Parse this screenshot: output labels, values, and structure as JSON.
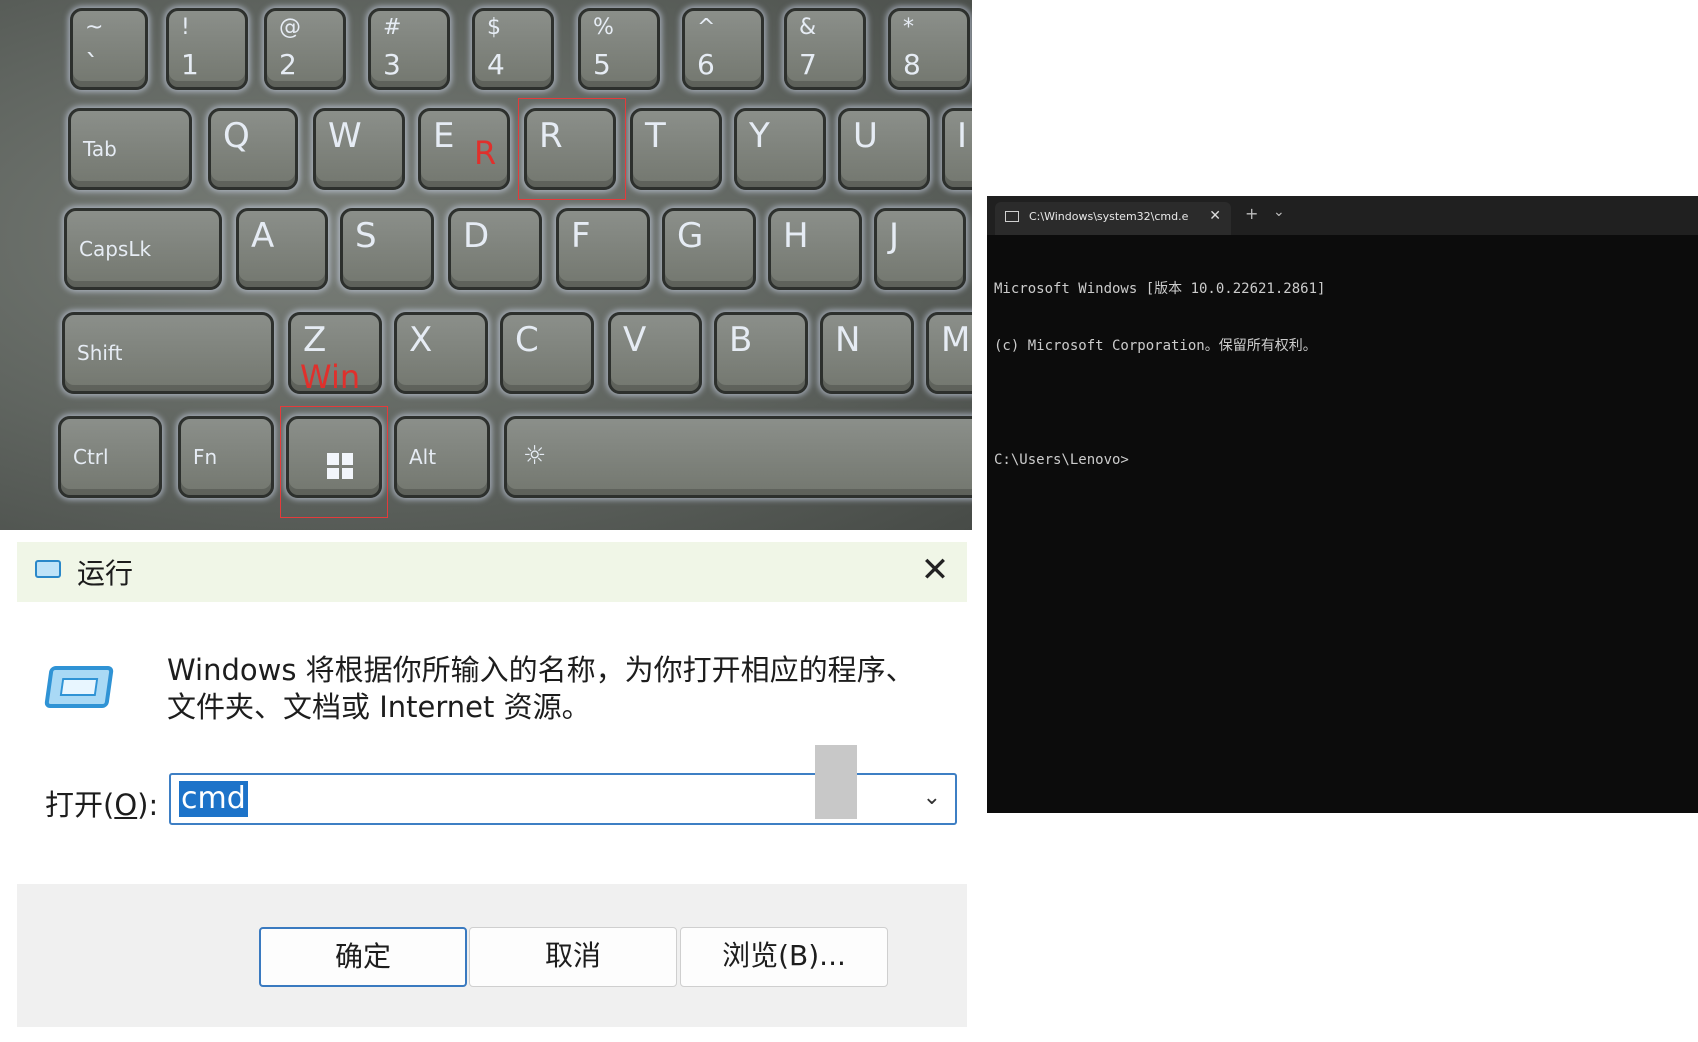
{
  "keyboard": {
    "row1": [
      {
        "sym": "~",
        "num": "`"
      },
      {
        "sym": "!",
        "num": "1"
      },
      {
        "sym": "@",
        "num": "2"
      },
      {
        "sym": "#",
        "num": "3"
      },
      {
        "sym": "$",
        "num": "4"
      },
      {
        "sym": "%",
        "num": "5"
      },
      {
        "sym": "^",
        "num": "6"
      },
      {
        "sym": "&",
        "num": "7"
      },
      {
        "sym": "*",
        "num": "8"
      }
    ],
    "tab": "Tab",
    "row2": [
      "Q",
      "W",
      "E",
      "R",
      "T",
      "Y",
      "U",
      "I"
    ],
    "capslock": "CapsLk",
    "row3": [
      "A",
      "S",
      "D",
      "F",
      "G",
      "H",
      "J"
    ],
    "shift": "Shift",
    "row4": [
      "Z",
      "X",
      "C",
      "V",
      "B",
      "N",
      "M"
    ],
    "ctrl": "Ctrl",
    "fn": "Fn",
    "alt": "Alt",
    "annotation_r": "R",
    "annotation_win": "Win"
  },
  "run_dialog": {
    "title": "运行",
    "close_glyph": "✕",
    "description": "Windows 将根据你所输入的名称，为你打开相应的程序、文件夹、文档或 Internet 资源。",
    "open_label_prefix": "打开(",
    "open_label_accel": "O",
    "open_label_suffix": "):",
    "input_value": "cmd",
    "dropdown_glyph": "⌄",
    "ok_label": "确定",
    "cancel_label": "取消",
    "browse_label": "浏览(B)..."
  },
  "cmd_window": {
    "tab_title": "C:\\Windows\\system32\\cmd.e",
    "tab_close": "✕",
    "new_tab": "+",
    "dropdown": "⌄",
    "lines": [
      "Microsoft Windows [版本 10.0.22621.2861]",
      "(c) Microsoft Corporation。保留所有权利。",
      "",
      "C:\\Users\\Lenovo>"
    ]
  }
}
